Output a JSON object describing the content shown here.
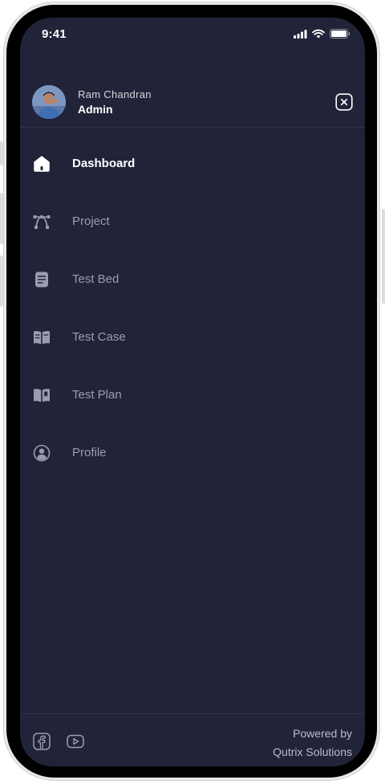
{
  "status_bar": {
    "time": "9:41"
  },
  "user": {
    "name": "Ram Chandran",
    "role": "Admin"
  },
  "menu": {
    "items": [
      {
        "label": "Dashboard",
        "icon": "home-icon",
        "active": true
      },
      {
        "label": "Project",
        "icon": "bezier-curve-icon",
        "active": false
      },
      {
        "label": "Test Bed",
        "icon": "document-icon",
        "active": false
      },
      {
        "label": "Test Case",
        "icon": "book-icon",
        "active": false
      },
      {
        "label": "Test Plan",
        "icon": "bookmark-book-icon",
        "active": false
      },
      {
        "label": "Profile",
        "icon": "user-circle-icon",
        "active": false
      }
    ]
  },
  "footer": {
    "social": [
      "facebook-icon",
      "youtube-icon"
    ],
    "powered_line1": "Powered by",
    "powered_line2": "Qutrix Solutions"
  },
  "colors": {
    "background": "#212438",
    "active_text": "#ffffff",
    "inactive_text": "#9a9db0",
    "divider": "#2f3349"
  }
}
